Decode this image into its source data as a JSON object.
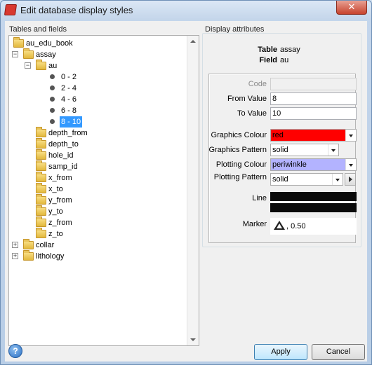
{
  "window": {
    "title": "Edit database display styles",
    "close_symbol": "✕"
  },
  "tree": {
    "group_label": "Tables and fields",
    "root": "au_edu_book",
    "assay": "assay",
    "au": "au",
    "ranges": [
      "0  -  2",
      "2  -  4",
      "4  -  6",
      "6  -  8",
      "8  -  10"
    ],
    "selected_range_index": 4,
    "fields": [
      "depth_from",
      "depth_to",
      "hole_id",
      "samp_id",
      "x_from",
      "x_to",
      "y_from",
      "y_to",
      "z_from",
      "z_to"
    ],
    "collar": "collar",
    "lithology": "lithology",
    "expanded_symbol": "−",
    "collapsed_symbol": "+"
  },
  "attributes": {
    "group_label": "Display attributes",
    "table_label": "Table",
    "table_value": "assay",
    "field_label": "Field",
    "field_value": "au",
    "code_label": "Code",
    "code_value": "",
    "from_label": "From Value",
    "from_value": "8",
    "to_label": "To Value",
    "to_value": "10",
    "graphics_colour_label": "Graphics Colour",
    "graphics_colour_value": "red",
    "graphics_colour_hex": "#ff0000",
    "graphics_pattern_label": "Graphics Pattern",
    "graphics_pattern_value": "solid",
    "plotting_colour_label": "Plotting Colour",
    "plotting_colour_value": "periwinkle",
    "plotting_colour_hex": "#b3b3ff",
    "plotting_pattern_label": "Plotting Pattern",
    "plotting_pattern_value": "solid",
    "line_label": "Line",
    "line_colour_hex": "#0a0a0a",
    "marker_label": "Marker",
    "marker_value": ", 0.50"
  },
  "buttons": {
    "help": "?",
    "apply": "Apply",
    "cancel": "Cancel"
  }
}
